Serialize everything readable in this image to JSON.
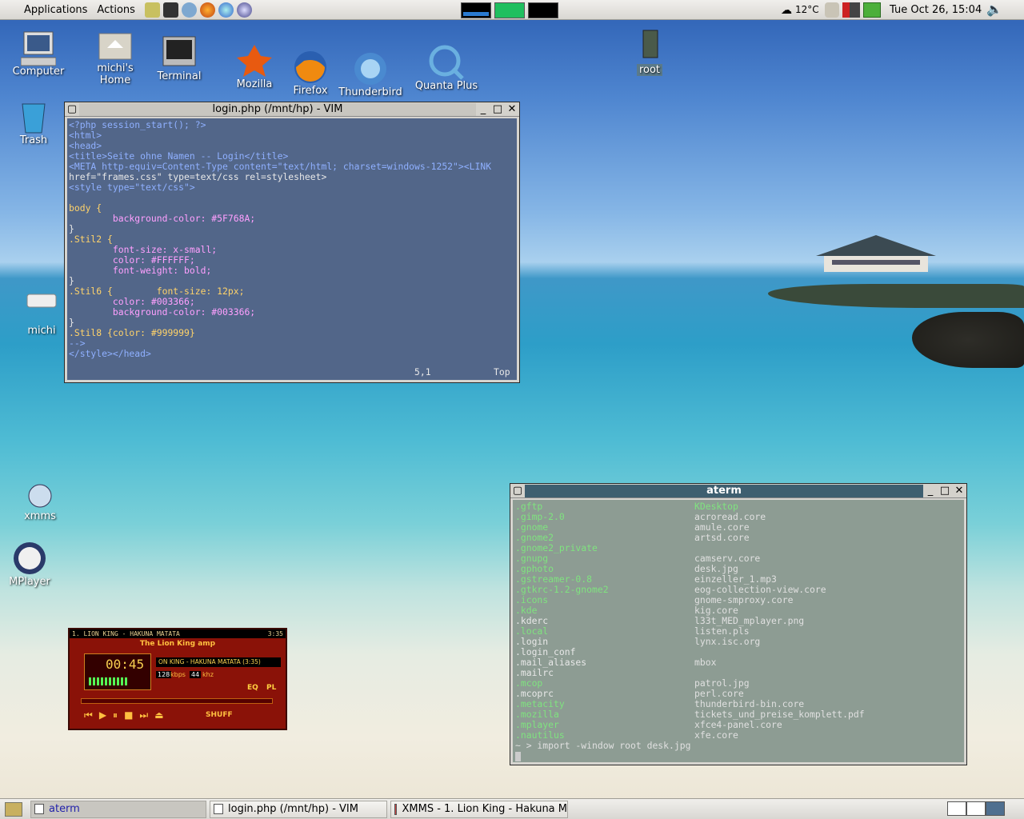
{
  "top_panel": {
    "menus": [
      "Applications",
      "Actions"
    ],
    "weather": "12°C",
    "clock": "Tue Oct 26, 15:04"
  },
  "desktop_icons": [
    {
      "id": "computer",
      "label": "Computer"
    },
    {
      "id": "home",
      "label": "michi's Home"
    },
    {
      "id": "terminal",
      "label": "Terminal"
    },
    {
      "id": "mozilla",
      "label": "Mozilla"
    },
    {
      "id": "firefox",
      "label": "Firefox"
    },
    {
      "id": "thunderbird",
      "label": "Thunderbird"
    },
    {
      "id": "quanta",
      "label": "Quanta Plus"
    },
    {
      "id": "root",
      "label": "root"
    },
    {
      "id": "trash",
      "label": "Trash"
    },
    {
      "id": "michi",
      "label": "michi"
    },
    {
      "id": "xmms",
      "label": "xmms"
    },
    {
      "id": "mplayer",
      "label": "MPlayer"
    }
  ],
  "vim": {
    "title": "login.php (/mnt/hp) - VIM",
    "status_pos": "5,1",
    "status_scroll": "Top",
    "lines": [
      "<?php session_start(); ?>",
      "<html>",
      "<head>",
      "<title>Seite ohne Namen -- Login</title>",
      "<META http-equiv=Content-Type content=\"text/html; charset=windows-1252\"><LINK",
      "href=\"frames.css\" type=text/css rel=stylesheet>",
      "<style type=\"text/css\">",
      "",
      "body {",
      "        background-color: #5F768A;",
      "}",
      ".Stil2 {",
      "        font-size: x-small;",
      "        color: #FFFFFF;",
      "        font-weight: bold;",
      "}",
      ".Stil6 {        font-size: 12px;",
      "        color: #003366;",
      "        background-color: #003366;",
      "}",
      ".Stil8 {color: #999999}",
      "-->",
      "</style></head>"
    ]
  },
  "aterm": {
    "title": "aterm",
    "left_col": [
      ".gftp",
      ".gimp-2.0",
      ".gnome",
      ".gnome2",
      ".gnome2_private",
      ".gnupg",
      ".gphoto",
      ".gstreamer-0.8",
      ".gtkrc-1.2-gnome2",
      ".icons",
      ".kde",
      ".kderc",
      ".local",
      ".login",
      ".login_conf",
      ".mail_aliases",
      ".mailrc",
      ".mcop",
      ".mcoprc",
      ".metacity",
      ".mozilla",
      ".mplayer",
      ".nautilus"
    ],
    "right_col": [
      "KDesktop",
      "acroread.core",
      "amule.core",
      "artsd.core",
      "",
      "camserv.core",
      "desk.jpg",
      "einzeller_1.mp3",
      "eog-collection-view.core",
      "gnome-smproxy.core",
      "kig.core",
      "l33t_MED_mplayer.png",
      "listen.pls",
      "lynx.isc.org",
      "",
      "mbox",
      "",
      "patrol.jpg",
      "perl.core",
      "thunderbird-bin.core",
      "tickets_und_preise_komplett.pdf",
      "xfce4-panel.core",
      "xfe.core"
    ],
    "prompt": "~ > import -window root desk.jpg"
  },
  "xmms": {
    "titlebar": "1. LION KING - HAKUNA MATATA",
    "time_small": "3:35",
    "skin": "The Lion King amp",
    "time": "00:45",
    "scroll": "ON KING - HAKUNA MATATA (3:35)",
    "kbps": "128",
    "khz": "44",
    "btn_eq": "EQ",
    "btn_pl": "PL",
    "shuffle": "SHUFF"
  },
  "taskbar": [
    {
      "label": "aterm"
    },
    {
      "label": "login.php (/mnt/hp) - VIM"
    },
    {
      "label": "XMMS - 1. Lion King - Hakuna M"
    }
  ]
}
